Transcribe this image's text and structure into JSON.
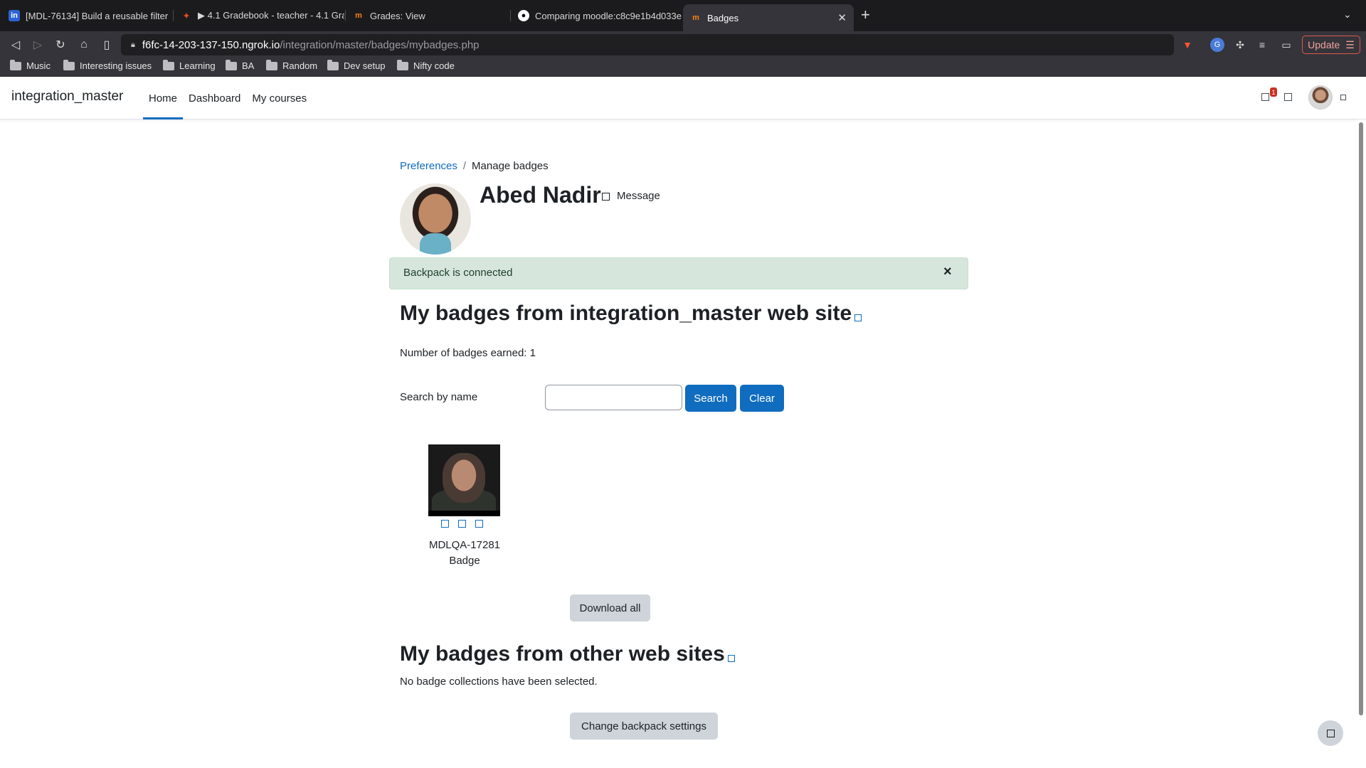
{
  "browser": {
    "tabs": [
      {
        "label": "[MDL-76134] Build a reusable filter",
        "icon": "jira-icon"
      },
      {
        "label": "▶ 4.1 Gradebook - teacher - 4.1 Gra",
        "icon": "figma-icon"
      },
      {
        "label": "Grades: View",
        "icon": "moodle-icon"
      },
      {
        "label": "Comparing moodle:c8c9e1b4d033e",
        "icon": "github-icon"
      },
      {
        "label": "Badges",
        "icon": "moodle-icon",
        "active": true
      }
    ],
    "url_host": "f6fc-14-203-137-150.ngrok.io",
    "url_path": "/integration/master/badges/mybadges.php",
    "update_label": "Update",
    "bookmarks": [
      "Music",
      "Interesting issues",
      "Learning",
      "BA",
      "Random",
      "Dev setup",
      "Nifty code"
    ]
  },
  "navbar": {
    "site_name": "integration_master",
    "links": [
      "Home",
      "Dashboard",
      "My courses"
    ],
    "notification_count": "1"
  },
  "breadcrumb": {
    "parent": "Preferences",
    "current": "Manage badges"
  },
  "profile": {
    "name": "Abed Nadir",
    "message_label": "Message"
  },
  "alert": {
    "text": "Backpack is connected",
    "close": "×"
  },
  "site_badges": {
    "heading": "My badges from integration_master web site",
    "count_text": "Number of badges earned: 1",
    "search_label": "Search by name",
    "search_value": "",
    "search_button": "Search",
    "clear_button": "Clear",
    "badges": [
      {
        "name": "MDLQA-17281 Badge"
      }
    ],
    "download_all": "Download all"
  },
  "other_badges": {
    "heading": "My badges from other web sites",
    "empty_text": "No badge collections have been selected.",
    "settings_button": "Change backpack settings"
  },
  "colors": {
    "primary": "#0f6cbf",
    "alert_bg": "#d7e6dc",
    "secondary_btn": "#ced4da"
  }
}
